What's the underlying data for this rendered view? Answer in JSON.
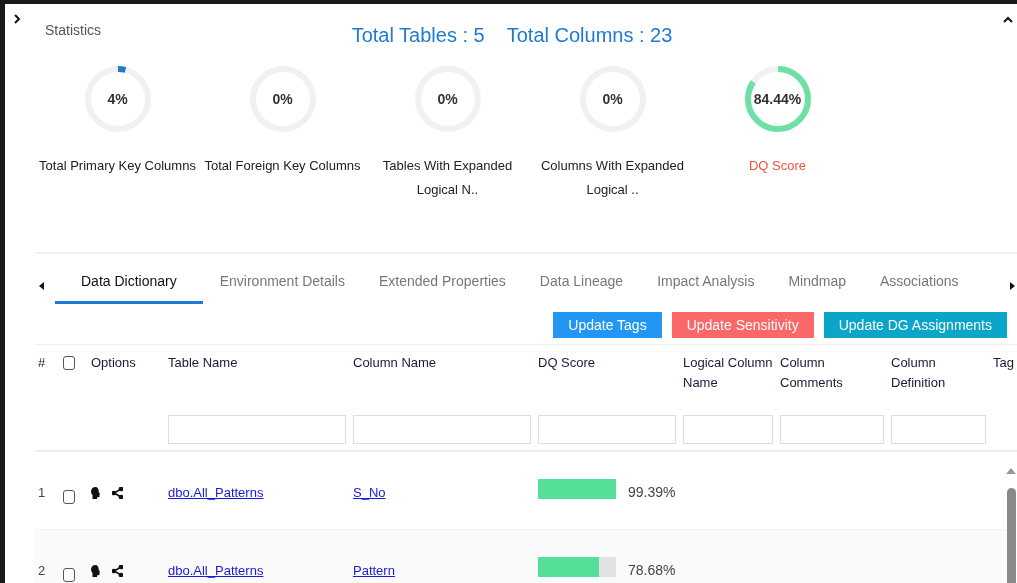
{
  "panel": {
    "title": "Statistics",
    "expanded": true,
    "totals": [
      "Total Tables : 5",
      "Total Columns : 23"
    ]
  },
  "gauges": [
    {
      "reading": "4%",
      "level": 0.04,
      "label": "Total Primary Key Columns",
      "kind": "plain"
    },
    {
      "reading": "0%",
      "level": 0,
      "label": "Total Foreign Key Columns",
      "kind": "plain"
    },
    {
      "reading": "0%",
      "level": 0,
      "label": "Tables With Expanded Logical N..",
      "kind": "plain"
    },
    {
      "reading": "0%",
      "level": 0,
      "label": "Columns With Expanded Logical ..",
      "kind": "plain"
    },
    {
      "reading": "84.44%",
      "level": 0.8444,
      "label": "DQ Score",
      "kind": "score"
    }
  ],
  "tabs": [
    {
      "label": "Data Dictionary",
      "selected": true
    },
    {
      "label": "Environment Details",
      "selected": false
    },
    {
      "label": "Extended Properties",
      "selected": false
    },
    {
      "label": "Data Lineage",
      "selected": false
    },
    {
      "label": "Impact Analysis",
      "selected": false
    },
    {
      "label": "Mindmap",
      "selected": false
    },
    {
      "label": "Associations",
      "selected": false
    }
  ],
  "actions": [
    {
      "label": "Update Tags",
      "kind": "tags"
    },
    {
      "label": "Update Sensitivity",
      "kind": "sensitivity"
    },
    {
      "label": "Update DG Assignments",
      "kind": "dg"
    }
  ],
  "table": {
    "select_all_checked": false,
    "columns": [
      {
        "label": "#",
        "kind": "index"
      },
      {
        "kind": "check"
      },
      {
        "label": "Options",
        "kind": "options"
      },
      {
        "label": "Table Name",
        "kind": "filter"
      },
      {
        "label": "Column Name",
        "kind": "filter"
      },
      {
        "label": "DQ Score",
        "kind": "filter"
      },
      {
        "label": "Logical Column Name",
        "kind": "filter"
      },
      {
        "label": "Column Comments",
        "kind": "filter"
      },
      {
        "label": "Column Definition",
        "kind": "filter"
      },
      {
        "label": "Tag",
        "kind": "plain"
      }
    ],
    "rows": [
      {
        "number": "1",
        "checked": false,
        "table_name": "dbo.All_Patterns",
        "column_name": "S_No",
        "level": 0.9939,
        "dq_reading": "99.39%"
      },
      {
        "number": "2",
        "checked": false,
        "table_name": "dbo.All_Patterns",
        "column_name": "Pattern",
        "level": 0.7868,
        "dq_reading": "78.68%"
      }
    ]
  }
}
